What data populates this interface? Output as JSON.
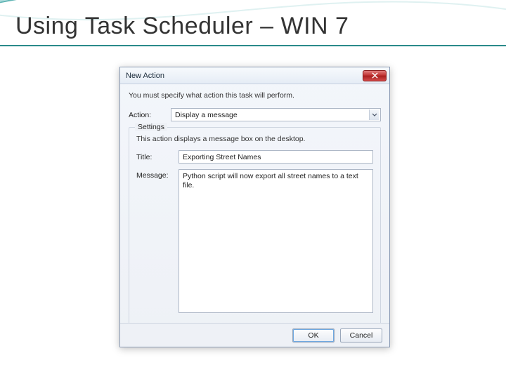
{
  "slide": {
    "title": "Using Task Scheduler – WIN 7"
  },
  "dialog": {
    "title": "New Action",
    "instruction": "You must specify what action this task will perform.",
    "action_label": "Action:",
    "action_value": "Display a message",
    "settings_group": "Settings",
    "settings_desc": "This action displays a message box on the desktop.",
    "title_label": "Title:",
    "title_value": "Exporting Street Names",
    "message_label": "Message:",
    "message_value": "Python script will now export all street names to a text file.",
    "ok": "OK",
    "cancel": "Cancel"
  }
}
